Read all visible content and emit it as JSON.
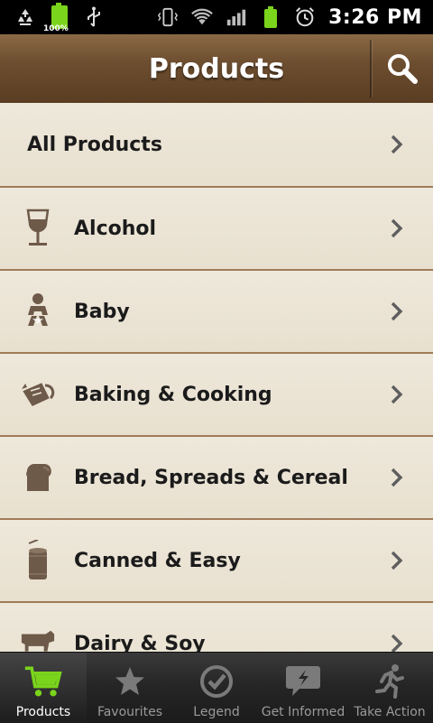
{
  "status_bar": {
    "battery_text": "100%",
    "time": "3:26 PM"
  },
  "header": {
    "title": "Products"
  },
  "list": {
    "items": [
      {
        "label": "All Products",
        "icon": "none"
      },
      {
        "label": "Alcohol",
        "icon": "wine-glass-icon"
      },
      {
        "label": "Baby",
        "icon": "baby-icon"
      },
      {
        "label": "Baking & Cooking",
        "icon": "measuring-jug-icon"
      },
      {
        "label": "Bread, Spreads & Cereal",
        "icon": "bread-icon"
      },
      {
        "label": "Canned & Easy",
        "icon": "can-icon"
      },
      {
        "label": "Dairy & Soy",
        "icon": "cow-icon"
      }
    ]
  },
  "bottom_nav": {
    "tabs": [
      {
        "label": "Products",
        "icon": "cart-icon",
        "active": true
      },
      {
        "label": "Favourites",
        "icon": "star-icon",
        "active": false
      },
      {
        "label": "Legend",
        "icon": "check-circle-icon",
        "active": false
      },
      {
        "label": "Get Informed",
        "icon": "speech-bubble-icon",
        "active": false
      },
      {
        "label": "Take Action",
        "icon": "running-man-icon",
        "active": false
      }
    ]
  },
  "colors": {
    "accent_green": "#7ad41c",
    "header_brown": "#6d4e30",
    "divider_brown": "#a07b58",
    "icon_brown": "#6e5a49"
  }
}
